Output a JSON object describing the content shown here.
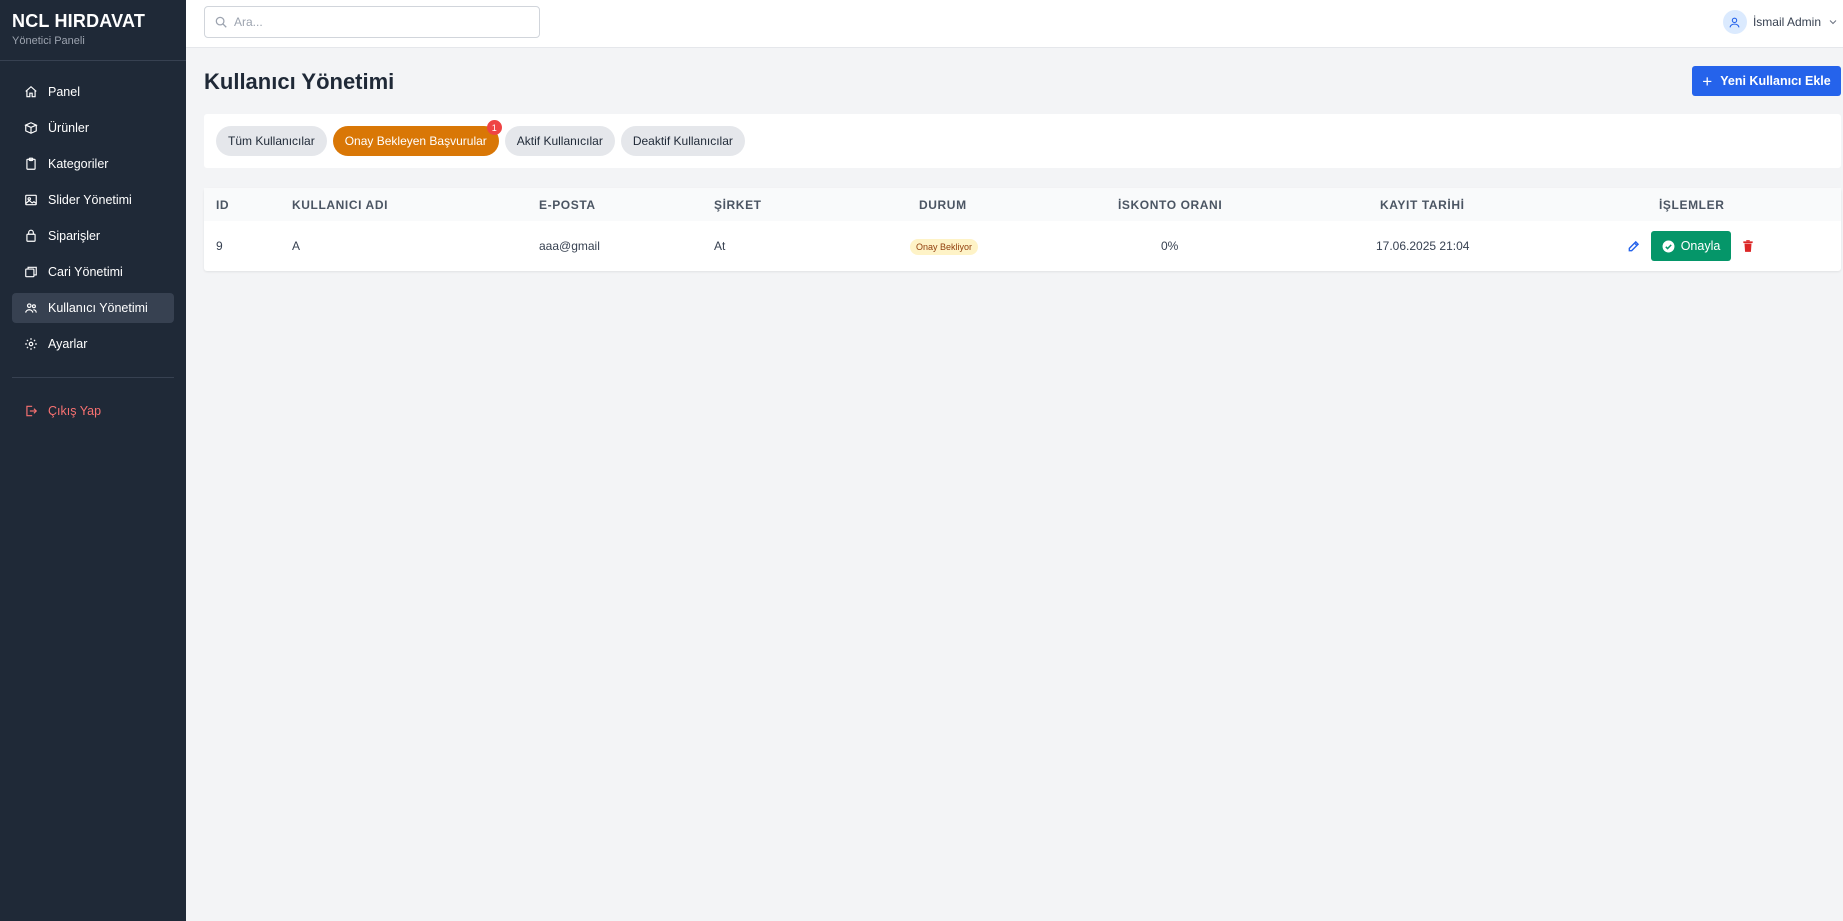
{
  "sidebar": {
    "brand_title": "NCL HIRDAVAT",
    "brand_subtitle": "Yönetici Paneli",
    "items": [
      {
        "label": "Panel",
        "icon": "home-icon"
      },
      {
        "label": "Ürünler",
        "icon": "box-icon"
      },
      {
        "label": "Kategoriler",
        "icon": "clipboard-icon"
      },
      {
        "label": "Slider Yönetimi",
        "icon": "image-icon"
      },
      {
        "label": "Siparişler",
        "icon": "shopping-bag-icon"
      },
      {
        "label": "Cari Yönetimi",
        "icon": "layers-icon"
      },
      {
        "label": "Kullanıcı Yönetimi",
        "icon": "users-icon",
        "active": true
      },
      {
        "label": "Ayarlar",
        "icon": "gear-icon"
      }
    ],
    "logout_label": "Çıkış Yap"
  },
  "topbar": {
    "search_placeholder": "Ara...",
    "user_name": "İsmail Admin"
  },
  "page": {
    "title": "Kullanıcı Yönetimi",
    "add_button_label": "Yeni Kullanıcı Ekle"
  },
  "tabs": [
    {
      "label": "Tüm Kullanıcılar"
    },
    {
      "label": "Onay Bekleyen Başvurular",
      "active": true,
      "badge": "1"
    },
    {
      "label": "Aktif Kullanıcılar"
    },
    {
      "label": "Deaktif Kullanıcılar"
    }
  ],
  "table": {
    "headers": [
      "ID",
      "KULLANICI ADI",
      "E-POSTA",
      "ŞİRKET",
      "DURUM",
      "İSKONTO ORANI",
      "KAYIT TARİHİ",
      "İŞLEMLER"
    ],
    "rows": [
      {
        "id": "9",
        "username": "A",
        "email": "aaa@gmail",
        "company": "At",
        "status": "Onay Bekliyor",
        "discount": "0%",
        "registered": "17.06.2025 21:04",
        "approve_label": "Onayla"
      }
    ]
  },
  "colors": {
    "sidebar_bg": "#1f2937",
    "primary": "#2563eb",
    "active_tab": "#d97706",
    "approve": "#059669",
    "danger": "#ef4444"
  }
}
